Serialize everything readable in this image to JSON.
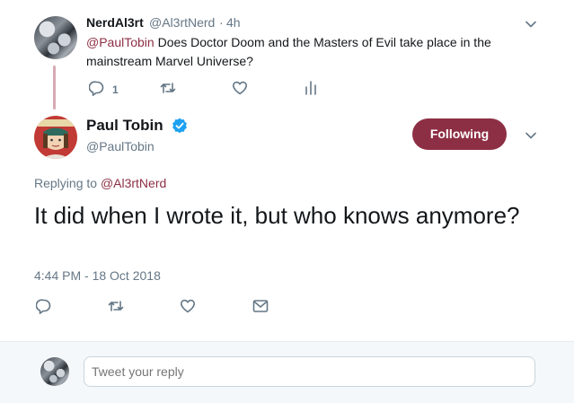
{
  "reply_tweet": {
    "display_name": "NerdAl3rt",
    "handle": "@Al3rtNerd",
    "separator": "·",
    "time": "4h",
    "mention": "@PaulTobin",
    "text": " Does Doctor Doom and the Masters of Evil take place in the mainstream Marvel Universe?",
    "reply_count": "1"
  },
  "main_tweet": {
    "display_name": "Paul Tobin",
    "handle": "@PaulTobin",
    "follow_label": "Following",
    "replying_prefix": "Replying to ",
    "replying_to": "@Al3rtNerd",
    "text": "It did when I wrote it, but who knows anymore?",
    "timestamp": "4:44 PM - 18 Oct 2018"
  },
  "reply_box": {
    "placeholder": "Tweet your reply"
  },
  "colors": {
    "accent": "#8d2f44",
    "muted_text": "#657786",
    "verified_blue": "#1da1f2"
  },
  "icons": [
    "reply-icon",
    "retweet-icon",
    "like-icon",
    "analytics-icon",
    "message-icon",
    "chevron-down-icon",
    "verified-badge-icon"
  ]
}
